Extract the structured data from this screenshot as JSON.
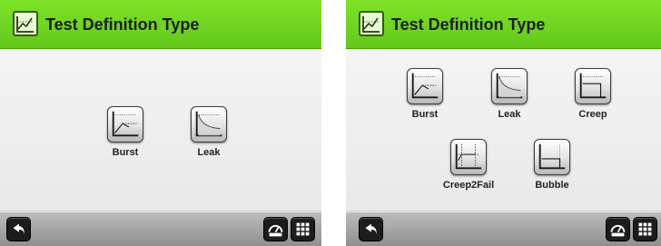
{
  "panels": [
    {
      "title": "Test Definition Type",
      "tests": [
        {
          "label": "Burst",
          "icon": "burst-chart-icon"
        },
        {
          "label": "Leak",
          "icon": "leak-chart-icon"
        }
      ],
      "footer": {
        "back_icon": "back-arrow-icon",
        "right_icons": [
          "gauge-icon",
          "grid-menu-icon"
        ]
      }
    },
    {
      "title": "Test Definition Type",
      "tests": [
        {
          "label": "Burst",
          "icon": "burst-chart-icon"
        },
        {
          "label": "Leak",
          "icon": "leak-chart-icon"
        },
        {
          "label": "Creep",
          "icon": "creep-chart-icon"
        },
        {
          "label": "Creep2Fail",
          "icon": "creep2fail-chart-icon"
        },
        {
          "label": "Bubble",
          "icon": "bubble-chart-icon"
        }
      ],
      "footer": {
        "back_icon": "back-arrow-icon",
        "right_icons": [
          "gauge-icon",
          "grid-menu-icon"
        ]
      }
    }
  ],
  "colors": {
    "header_green": "#6ad320",
    "content_bg": "#efefef",
    "footer_gray": "#a6a6a6",
    "icon_dark": "#1c1c1c"
  }
}
